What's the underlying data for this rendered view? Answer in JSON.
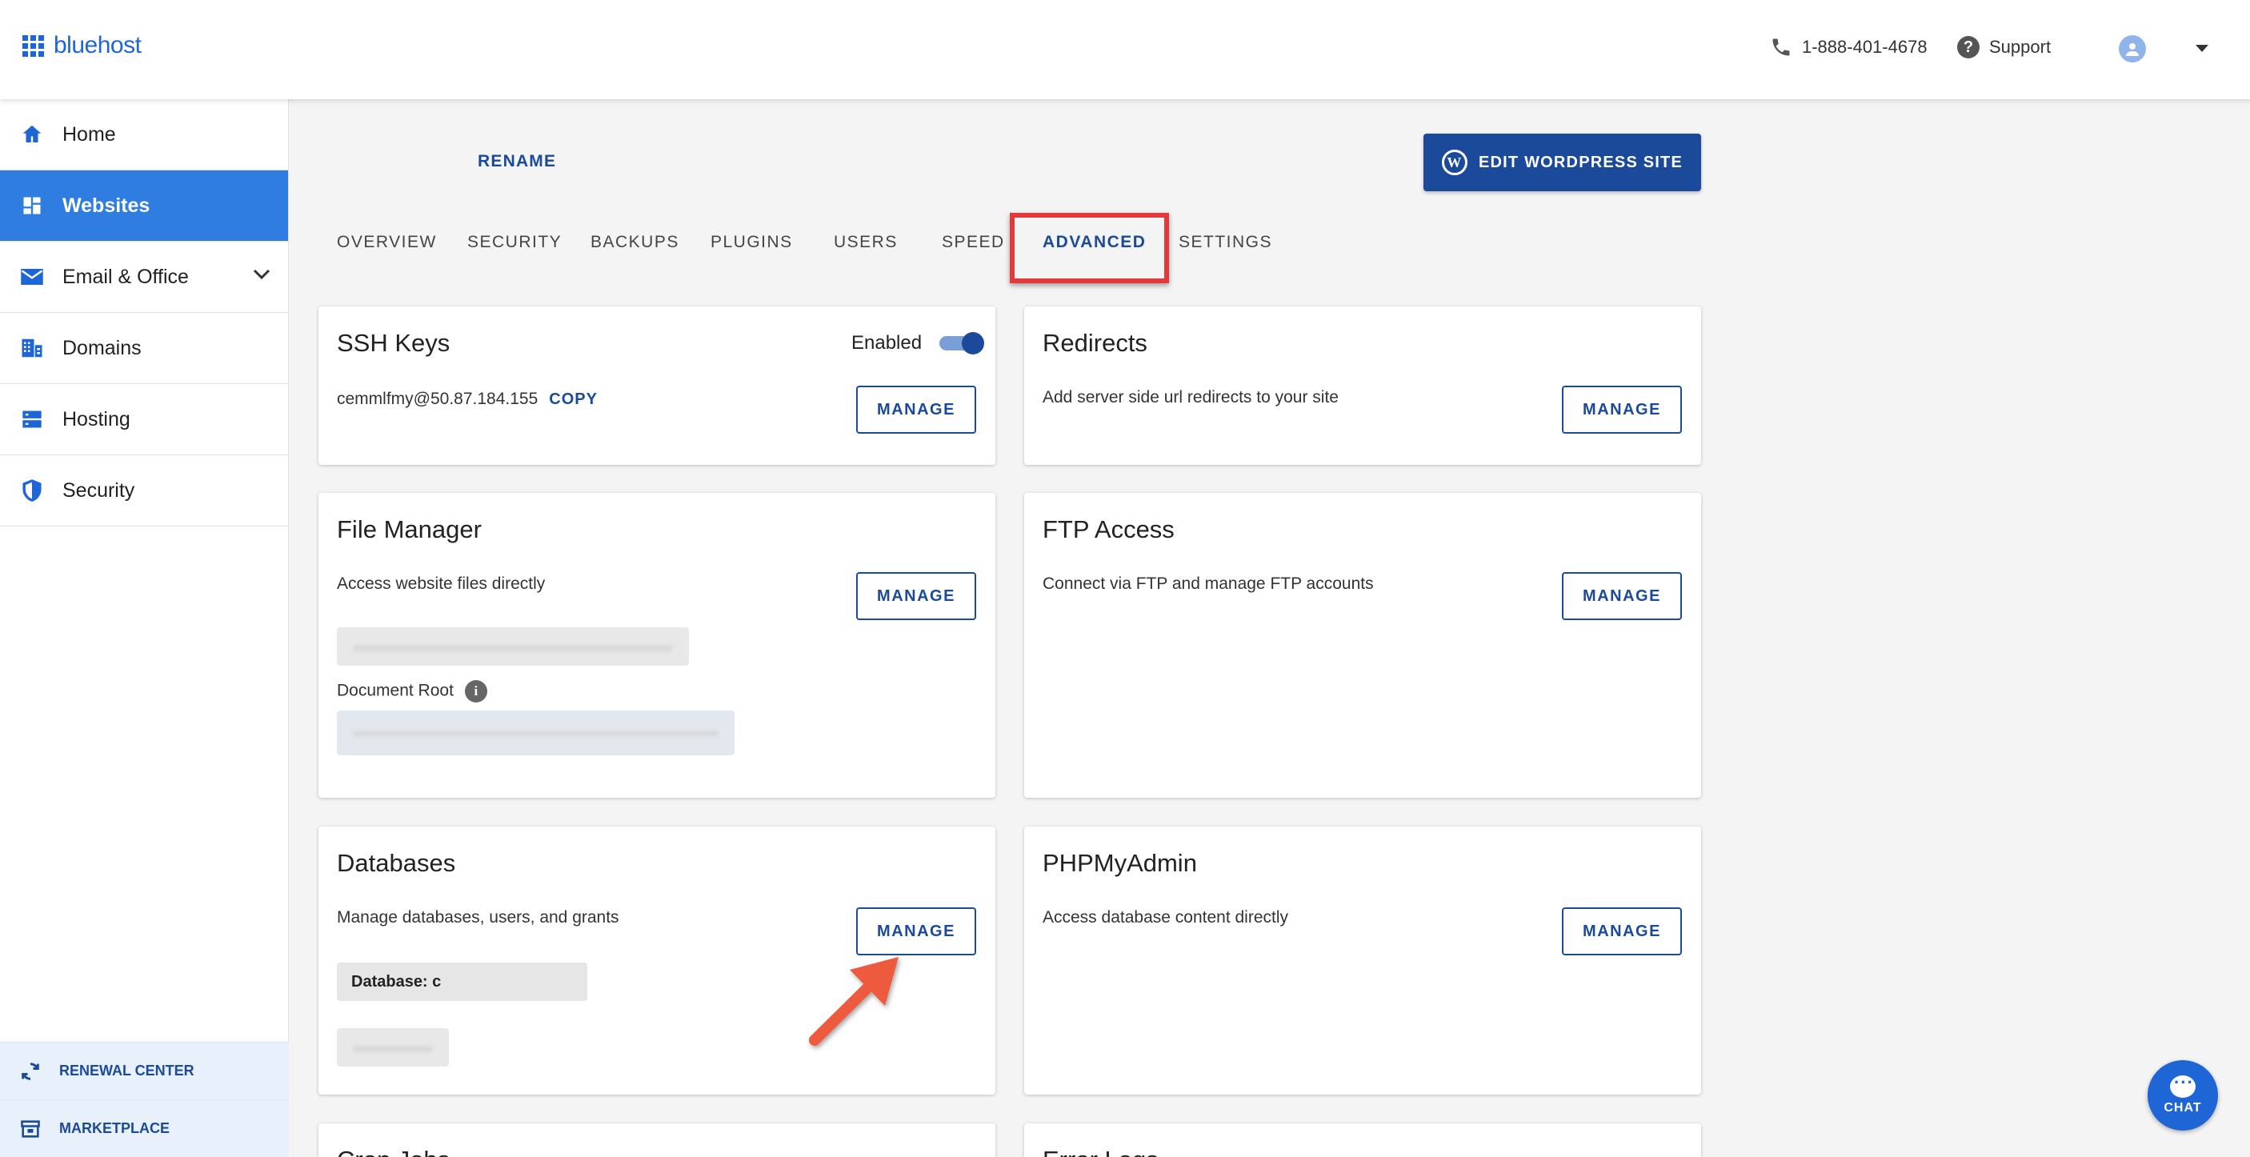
{
  "header": {
    "brand": "bluehost",
    "phone": "1-888-401-4678",
    "support_label": "Support"
  },
  "sidebar": {
    "items": [
      {
        "label": "Home",
        "icon": "home-icon"
      },
      {
        "label": "Websites",
        "icon": "dashboard-icon",
        "active": true
      },
      {
        "label": "Email & Office",
        "icon": "mail-icon",
        "expandable": true
      },
      {
        "label": "Domains",
        "icon": "domains-icon"
      },
      {
        "label": "Hosting",
        "icon": "server-icon"
      },
      {
        "label": "Security",
        "icon": "shield-icon"
      }
    ],
    "bottom": [
      {
        "label": "RENEWAL CENTER",
        "icon": "refresh-icon"
      },
      {
        "label": "MARKETPLACE",
        "icon": "store-icon"
      }
    ]
  },
  "site": {
    "rename_label": "RENAME",
    "edit_label": "EDIT WORDPRESS SITE"
  },
  "tabs": [
    "OVERVIEW",
    "SECURITY",
    "BACKUPS",
    "PLUGINS",
    "USERS",
    "SPEED",
    "ADVANCED",
    "SETTINGS"
  ],
  "active_tab": "ADVANCED",
  "cards": {
    "ssh": {
      "title": "SSH Keys",
      "toggle_label": "Enabled",
      "toggle_on": true,
      "value": "cemmlfmy@50.87.184.155",
      "copy_label": "COPY",
      "button": "MANAGE"
    },
    "redirects": {
      "title": "Redirects",
      "desc": "Add server side url redirects to your site",
      "button": "MANAGE"
    },
    "file_manager": {
      "title": "File Manager",
      "desc": "Access website files directly",
      "doc_root_label": "Document Root",
      "button": "MANAGE"
    },
    "ftp": {
      "title": "FTP Access",
      "desc": "Connect via FTP and manage FTP accounts",
      "button": "MANAGE"
    },
    "databases": {
      "title": "Databases",
      "desc": "Manage databases, users, and grants",
      "db_label": "Database: c",
      "button": "MANAGE"
    },
    "phpmyadmin": {
      "title": "PHPMyAdmin",
      "desc": "Access database content directly",
      "button": "MANAGE"
    },
    "cron": {
      "title": "Cron Jobs"
    },
    "error_logs": {
      "title": "Error Logs"
    }
  },
  "chat": {
    "label": "CHAT"
  },
  "colors": {
    "brand": "#1e65d6",
    "accent": "#1b4a9b",
    "active_nav": "#2f7de1",
    "highlight": "#e23a3a",
    "arrow": "#ee5a3c"
  }
}
